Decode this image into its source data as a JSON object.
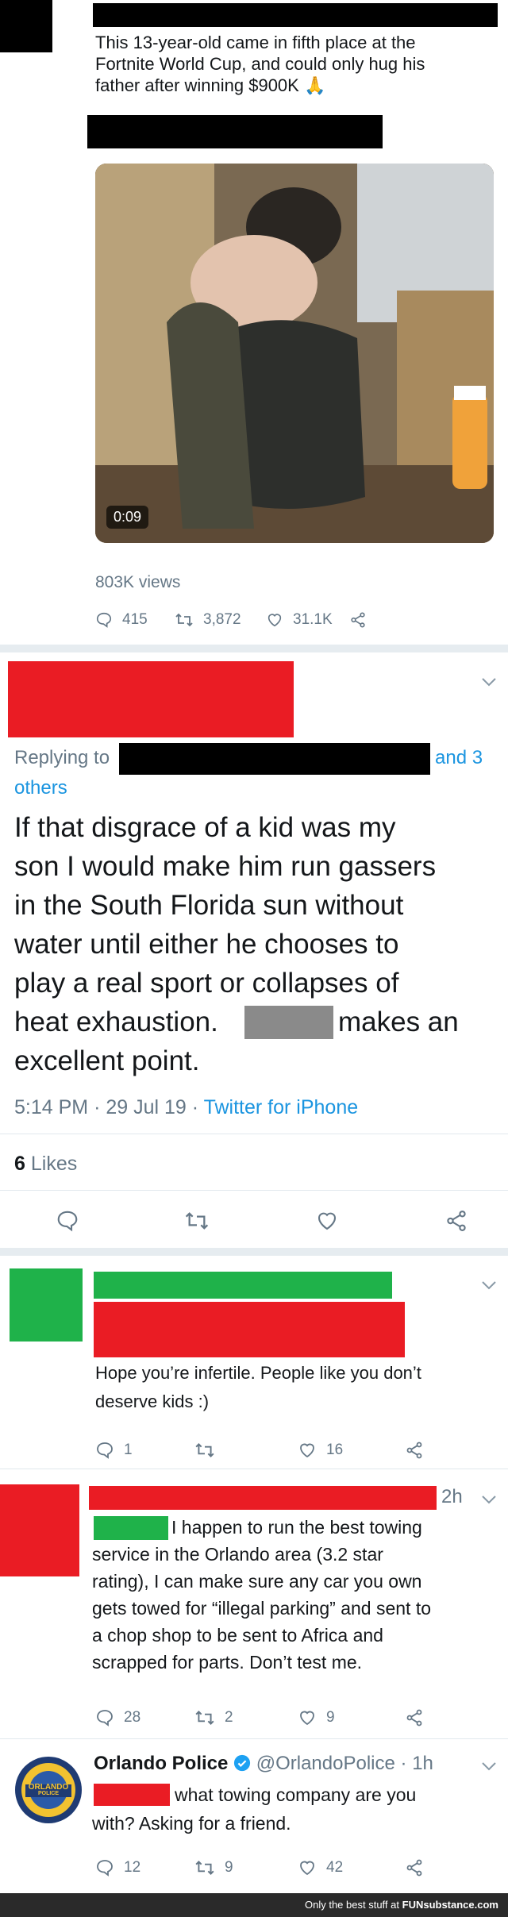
{
  "tweet1": {
    "text_lines": [
      "This 13-year-old came in fifth place at the",
      "Fortnite World Cup, and could only hug his",
      "father after winning $900K 🙏"
    ],
    "video_duration": "0:09",
    "views": "803K views",
    "replies": "415",
    "retweets": "3,872",
    "likes": "31.1K"
  },
  "tweet2": {
    "replying_prefix": "Replying to",
    "replying_suffix": "and 3",
    "replying_others": "others",
    "body_lines": [
      "If that disgrace of a kid was my",
      "son I would make him run gassers",
      "in the South Florida sun without",
      "water until either he chooses to",
      "play a real sport or collapses of",
      "heat exhaustion.",
      "makes an",
      "excellent point."
    ],
    "time": "5:14 PM",
    "date": "29 Jul 19",
    "source": "Twitter for iPhone",
    "likes_count": "6",
    "likes_label": "Likes"
  },
  "reply1": {
    "text_lines": [
      "Hope you’re infertile. People like you don’t",
      "deserve kids :)"
    ],
    "replies": "1",
    "retweets": "",
    "likes": "16"
  },
  "reply2": {
    "time": "2h",
    "text_lines": [
      "I happen to run the best towing",
      "service in the Orlando area (3.2 star",
      "rating), I can make sure any car you own",
      "gets towed for “illegal parking” and sent to",
      "a chop shop to be sent to Africa and",
      "scrapped for parts. Don’t test me."
    ],
    "replies": "28",
    "retweets": "2",
    "likes": "9"
  },
  "reply3": {
    "name": "Orlando Police",
    "handle": "@OrlandoPolice",
    "time": "1h",
    "text_lines": [
      "what towing company are you",
      "with? Asking for a friend."
    ],
    "replies": "12",
    "retweets": "9",
    "likes": "42",
    "badge_lines": [
      "ORLANDO",
      "POLICE"
    ]
  },
  "footer": {
    "text": "Only the best stuff at",
    "brand": "FUNsubstance.com"
  },
  "colors": {
    "redaction_red": "#ea1c24",
    "redaction_green": "#1fb24a",
    "redaction_black": "#000000",
    "link_blue": "#1b95e0",
    "muted_gray": "#657786",
    "verified_blue": "#1da1f2"
  }
}
